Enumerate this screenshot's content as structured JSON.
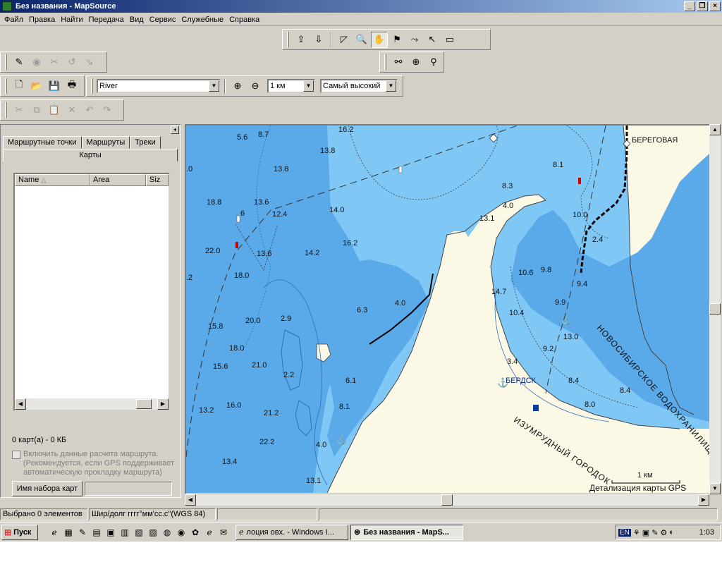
{
  "window": {
    "title": "Без названия - MapSource"
  },
  "menu": [
    "Файл",
    "Правка",
    "Найти",
    "Передача",
    "Вид",
    "Сервис",
    "Служебные",
    "Справка"
  ],
  "toolbar": {
    "map_selector": "River",
    "zoom_level": "1 км",
    "detail_level": "Самый высокий"
  },
  "left_panel": {
    "tabs": [
      "Маршрутные точки",
      "Маршруты",
      "Треки"
    ],
    "active_tab": "Карты",
    "columns": [
      "Name",
      "Area",
      "Siz"
    ],
    "summary": "0 карт(а) - 0 КБ",
    "checkbox_label": "Включить данные расчета маршрута. (Рекомендуется, если GPS поддерживает автоматическую прокладку маршрута)",
    "mapset_button": "Имя набора карт"
  },
  "map": {
    "place_labels": [
      "БЕРЕГОВАЯ",
      "БЕРДСК",
      "НОВОСИБИРСКОЕ ВОДОХРАНИЛИЩЕ",
      "ИЗУМРУДНЫЙ ГОРОДОК"
    ],
    "scale_label": "1 км",
    "detail_label": "Детализация карты GPS",
    "depths": [
      "16.2",
      "5.6",
      "8.7",
      "13.8",
      "13.8",
      ".0",
      "18.8",
      "6",
      "13.6",
      "12.4",
      "14.0",
      "22.0",
      "13.6",
      "14.2",
      "16.2",
      "18.0",
      ".2",
      "15.8",
      "20.0",
      "2.9",
      "6.3",
      "4.0",
      "18.0",
      "15.6",
      "21.0",
      "2.2",
      "6.1",
      "13.2",
      "16.0",
      "21.2",
      "8.1",
      "22.2",
      "4.0",
      "13.4",
      "13.1",
      "8.3",
      "13.1",
      "4.0",
      "8.1",
      "10.0",
      "2.4",
      "10.6",
      "9.8",
      "9.4",
      "14.7",
      "10.4",
      "9.9",
      "13.0",
      "9.2",
      "3.4",
      "8.4",
      "8.4",
      "8.0"
    ]
  },
  "status": {
    "selected": "Выбрано 0 элементов",
    "coords": "Шир/долг гггг°мм'сс.с\"(WGS 84)"
  },
  "taskbar": {
    "start": "Пуск",
    "tasks": [
      "лоция овх. - Windows I...",
      "Без названия - MapS..."
    ],
    "lang": "EN",
    "clock": "1:03"
  }
}
